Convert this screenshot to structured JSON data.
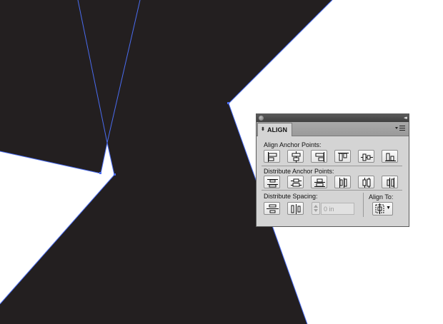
{
  "panel": {
    "tab_label": "ALIGN",
    "collapse_glyph": "◂◂",
    "align_anchor_points_label": "Align Anchor Points:",
    "distribute_anchor_points_label": "Distribute Anchor Points:",
    "distribute_spacing_label": "Distribute Spacing:",
    "align_to_label": "Align To:",
    "spacing_value": "0 in",
    "align_buttons": [
      "horizontal-align-left",
      "horizontal-align-center",
      "horizontal-align-right",
      "vertical-align-top",
      "vertical-align-center",
      "vertical-align-bottom"
    ],
    "distribute_buttons": [
      "vertical-distribute-top",
      "vertical-distribute-center",
      "vertical-distribute-bottom",
      "horizontal-distribute-left",
      "horizontal-distribute-center",
      "horizontal-distribute-right"
    ],
    "spacing_buttons": [
      "vertical-distribute-space",
      "horizontal-distribute-space"
    ]
  },
  "colors": {
    "shape_fill": "#231f20",
    "path_selection": "#4a6cf0",
    "panel_bg": "#d4d4d4",
    "titlebar": "#4a4a4a"
  }
}
